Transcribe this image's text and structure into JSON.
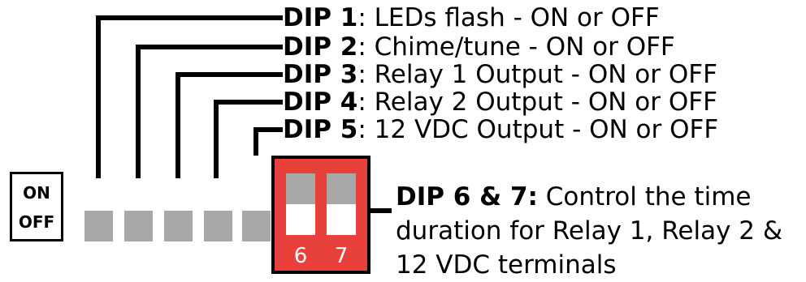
{
  "switch_box": {
    "on": "ON",
    "off": "OFF"
  },
  "dips": [
    {
      "id": "DIP 1",
      "desc": ":  LEDs flash - ON or OFF"
    },
    {
      "id": "DIP 2",
      "desc": ":  Chime/tune - ON or OFF"
    },
    {
      "id": "DIP 3",
      "desc": ":  Relay 1 Output - ON or OFF"
    },
    {
      "id": "DIP 4",
      "desc": ":  Relay 2 Output - ON or OFF"
    },
    {
      "id": "DIP 5",
      "desc": ":  12 VDC Output - ON or OFF"
    }
  ],
  "red_block": {
    "num_6": "6",
    "num_7": "7"
  },
  "dip67": {
    "id": "DIP 6 & 7:",
    "desc": "  Control the time duration for Relay 1, Relay 2 & 12 VDC terminals"
  },
  "colors": {
    "red": "#e8413c",
    "gray": "#a8a8a8"
  }
}
